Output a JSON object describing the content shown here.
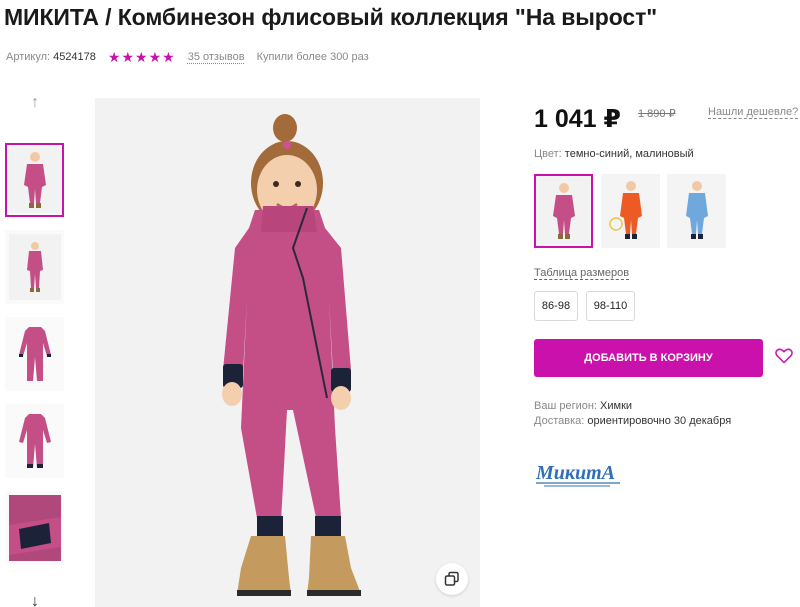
{
  "product": {
    "title": "МИКИТА / Комбинезон флисовый коллекция \"На вырост\"",
    "article_label": "Артикул:",
    "article_number": "4524178",
    "rating_stars": 5,
    "reviews": "35 отзывов",
    "bought": "Купили более 300 раз"
  },
  "gallery": {
    "arrow_up": "↑",
    "arrow_down": "↓",
    "thumbnails": [
      "photo-front",
      "photo-front-small",
      "flat-front",
      "flat-back",
      "cuff-detail"
    ]
  },
  "pricing": {
    "price": "1 041 ₽",
    "old_price": "1 890 ₽",
    "cheaper_link": "Нашли дешевле?"
  },
  "colors": {
    "label": "Цвет:",
    "value": "темно-синий, малиновый",
    "options": [
      "pink",
      "orange",
      "blue"
    ]
  },
  "sizes": {
    "table_link": "Таблица размеров",
    "options": [
      "86-98",
      "98-110"
    ]
  },
  "actions": {
    "add_to_cart": "ДОБАВИТЬ В КОРЗИНУ"
  },
  "delivery": {
    "region_label": "Ваш регион:",
    "region_value": "Химки",
    "delivery_label": "Доставка:",
    "delivery_value": "ориентировочно 30 декабря"
  },
  "brand": {
    "logo_text": "МикитА"
  },
  "theme": {
    "accent": "#cb11ab",
    "garment_pink": "#c44e86",
    "garment_orange": "#ee5a24",
    "garment_blue": "#6fa8dc",
    "cuff_navy": "#1c2238"
  }
}
